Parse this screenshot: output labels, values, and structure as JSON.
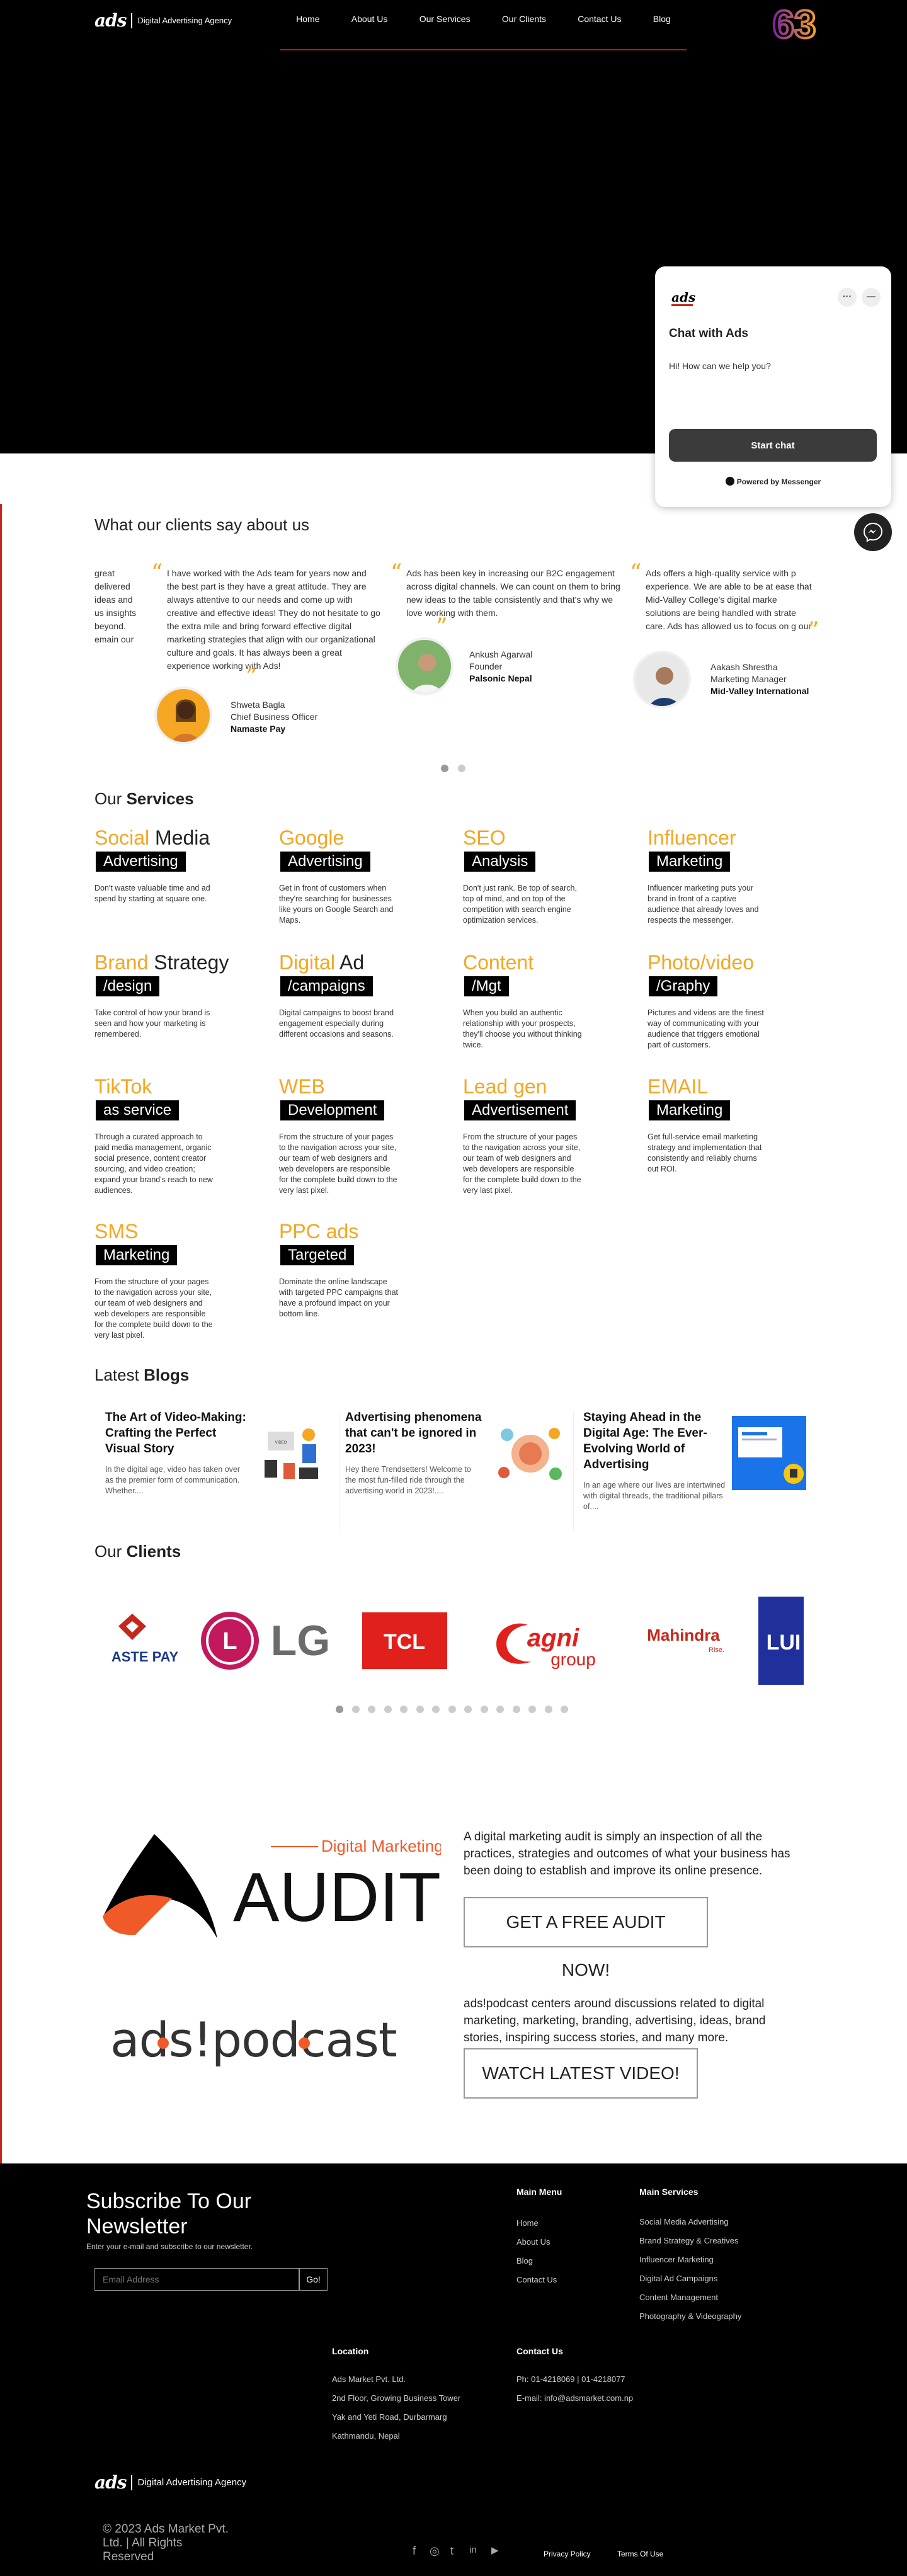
{
  "header": {
    "logo_mark": "ads",
    "logo_tagline": "Digital Advertising Agency",
    "nav": [
      "Home",
      "About Us",
      "Our Services",
      "Our Clients",
      "Contact Us",
      "Blog"
    ],
    "badge": "63"
  },
  "chat": {
    "title": "Chat with Ads",
    "greeting": "Hi! How can we help you?",
    "start_label": "Start chat",
    "powered": "Powered by Messenger",
    "dots1": "···",
    "dots2": "—"
  },
  "testimonials": {
    "title": "What our clients say about us",
    "items": [
      {
        "partial": "great\ndelivered\nideas and\nus insights\nbeyond.\nemain our"
      },
      {
        "text": "I have worked with the Ads team for years now and the best part is they have a great attitude. They are always attentive to our needs and come up with creative and effective ideas! They do not hesitate to go the extra mile and bring forward effective digital marketing strategies that align with our organizational culture and goals. It has always been a great experience working with Ads!",
        "name": "Shweta Bagla",
        "role": "Chief Business Officer",
        "company": "Namaste Pay"
      },
      {
        "text": "Ads has been key in increasing our B2C engagement across digital channels. We can count on them to bring new ideas to the table consistently and that's why we love working with them.",
        "name": "Ankush Agarwal",
        "role": "Founder",
        "company": "Palsonic Nepal"
      },
      {
        "text": "Ads offers a high-quality service with p experience. We are able to be at ease that Mid-Valley College's digital marke solutions are being handled with strate care. Ads has allowed us to focus on g our business! Highly recommended!",
        "name": "Aakash Shrestha",
        "role": "Marketing Manager",
        "company": "Mid-Valley International"
      }
    ],
    "active_dot": 0
  },
  "services": {
    "title_plain": "Our",
    "title_bold": "Services",
    "items": [
      {
        "a": "Social",
        "b": " Media",
        "tag": "Advertising",
        "desc": "Don't waste valuable time and ad spend by starting at square one."
      },
      {
        "a": "Google",
        "b": "",
        "tag": "Advertising",
        "desc": "Get in front of customers when they're searching for businesses like yours on Google Search and Maps."
      },
      {
        "a": "SEO",
        "b": "",
        "tag": "Analysis",
        "desc": "Don't just rank. Be top of search, top of mind, and on top of the competition with search engine optimization services."
      },
      {
        "a": "Influencer",
        "b": "",
        "tag": "Marketing",
        "desc": "Influencer marketing puts your brand in front of a captive audience that already loves and respects the messenger."
      },
      {
        "a": "Brand",
        "b": " Strategy",
        "tag": "/design",
        "desc": "Take control of how your brand is seen and how your marketing is remembered."
      },
      {
        "a": "Digital",
        "b": " Ad",
        "tag": "/campaigns",
        "desc": "Digital campaigns to boost brand engagement especially during different occasions and seasons."
      },
      {
        "a": "Content",
        "b": "",
        "tag": "/Mgt",
        "desc": "When you build an authentic relationship with your prospects, they'll choose you without thinking twice."
      },
      {
        "a": "Photo/video",
        "b": "",
        "tag": "/Graphy",
        "desc": "Pictures and videos are the finest way of communicating with your audience that triggers emotional part of customers."
      },
      {
        "a": "TikTok",
        "b": "",
        "tag": "as service",
        "desc": "Through a curated approach to paid media management, organic social presence, content creator sourcing, and video creation; expand your brand's reach to new audiences."
      },
      {
        "a": "WEB",
        "b": "",
        "tag": "Development",
        "desc": "From the structure of your pages to the navigation across your site, our team of web designers and web developers are responsible for the complete build down to the very last pixel."
      },
      {
        "a": "Lead gen",
        "b": "",
        "tag": "Advertisement",
        "desc": "From the structure of your pages to the navigation across your site, our team of web designers and web developers are responsible for the complete build down to the very last pixel."
      },
      {
        "a": "EMAIL",
        "b": "",
        "tag": "Marketing",
        "desc": "Get full-service email marketing strategy and implementation that consistently and reliably churns out ROI."
      },
      {
        "a": "SMS",
        "b": "",
        "tag": "Marketing",
        "desc": "From the structure of your pages to the navigation across your site, our team of web designers and web developers are responsible for the complete build down to the very last pixel."
      },
      {
        "a": "PPC ads",
        "b": "",
        "tag": "Targeted",
        "desc": "Dominate the online landscape with targeted PPC campaigns that have a profound impact on your bottom line."
      }
    ]
  },
  "blogs": {
    "title_plain": "Latest",
    "title_bold": "Blogs",
    "items": [
      {
        "title": "The Art of Video-Making: Crafting the Perfect Visual Story",
        "excerpt": "In the digital age, video has taken over as the premier form of communication. Whether...."
      },
      {
        "title": "Advertising phenomena that can't be ignored in 2023!",
        "excerpt": "Hey there Trendsetters! Welcome to the most fun-filled ride through the advertising world in 2023!...."
      },
      {
        "title": "Staying Ahead in the Digital Age: The Ever-Evolving World of Advertising",
        "excerpt": "In an age where our lives are intertwined with digital threads, the traditional pillars of...."
      }
    ]
  },
  "clients": {
    "title_plain": "Our",
    "title_bold": "Clients",
    "logos": [
      "ASTE PAY",
      "LG",
      "TCL",
      "agni group",
      "Mahindra",
      "LUI"
    ],
    "lg_letters": "LG",
    "agni_sub": "group",
    "mahindra_sub": "Rise.",
    "dot_count": 15,
    "active_dot": 0
  },
  "audit": {
    "kicker": "Digital Marketing",
    "word": "AUDIT",
    "text": "A digital marketing audit is simply an inspection of all the practices, strategies and outcomes of what your business has been doing to establish and improve its online presence.",
    "button": "GET A FREE AUDIT NOW!"
  },
  "podcast": {
    "logo_text": "ads!podcast",
    "text": "ads!podcast centers around discussions related to digital marketing, marketing, branding, advertising, ideas, brand stories, inspiring success stories, and many more.",
    "button": "WATCH LATEST VIDEO!"
  },
  "footer": {
    "newsletter_title": "Subscribe To Our Newsletter",
    "newsletter_sub": "Enter your e-mail and subscribe to our newsletter.",
    "email_placeholder": "Email Address",
    "go_label": "Go!",
    "main_menu_title": "Main Menu",
    "main_menu": [
      "Home",
      "About Us",
      "Blog",
      "Contact Us"
    ],
    "services_title": "Main Services",
    "services": [
      "Social Media Advertising",
      "Brand Strategy & Creatives",
      "Influencer Marketing",
      "Digital Ad Campaigns",
      "Content Management",
      "Photography & Videography"
    ],
    "location_title": "Location",
    "location": [
      "Ads Market Pvt. Ltd.",
      "2nd Floor, Growing Business Tower",
      "Yak and Yeti Road, Durbarmarg",
      "Kathmandu, Nepal"
    ],
    "contact_title": "Contact Us",
    "contact": [
      "Ph: 01-4218069 | 01-4218077",
      "E-mail: info@adsmarket.com.np"
    ],
    "logo_mark": "ads",
    "logo_tagline": "Digital Advertising Agency",
    "copyright": "© 2023 Ads Market Pvt. Ltd. | All Rights Reserved",
    "social_icons": [
      "facebook-icon",
      "instagram-icon",
      "twitter-icon",
      "linkedin-icon",
      "youtube-icon"
    ],
    "social_glyphs": [
      "f",
      "◎",
      "t",
      "in",
      "▶"
    ],
    "privacy": "Privacy Policy",
    "terms": "Terms Of Use"
  },
  "colors": {
    "accent": "#f5a623",
    "brand_red": "#c4281c",
    "black": "#000000"
  }
}
